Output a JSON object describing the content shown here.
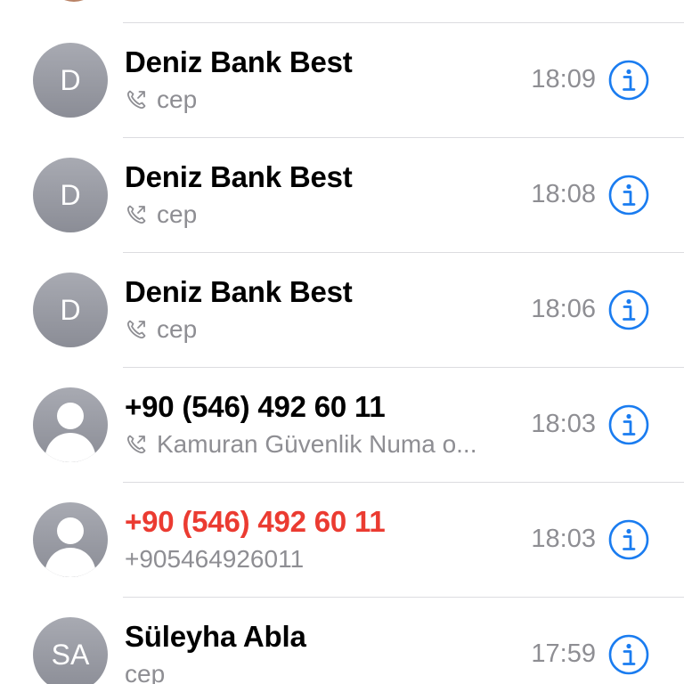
{
  "calls": [
    {
      "initials": "D",
      "avatar_type": "initials",
      "name": "Deniz Bank Best",
      "missed": false,
      "show_call_icon": true,
      "subtitle": "cep",
      "time": "18:09"
    },
    {
      "initials": "D",
      "avatar_type": "initials",
      "name": "Deniz Bank Best",
      "missed": false,
      "show_call_icon": true,
      "subtitle": "cep",
      "time": "18:08"
    },
    {
      "initials": "D",
      "avatar_type": "initials",
      "name": "Deniz Bank Best",
      "missed": false,
      "show_call_icon": true,
      "subtitle": "cep",
      "time": "18:06"
    },
    {
      "initials": "",
      "avatar_type": "silhouette",
      "name": "+90 (546) 492 60 11",
      "missed": false,
      "show_call_icon": true,
      "subtitle": "Kamuran Güvenlik Numa o...",
      "time": "18:03"
    },
    {
      "initials": "",
      "avatar_type": "silhouette",
      "name": "+90 (546) 492 60 11",
      "missed": true,
      "show_call_icon": false,
      "subtitle": "+905464926011",
      "time": "18:03"
    },
    {
      "initials": "SA",
      "avatar_type": "initials",
      "name": "Süleyha Abla",
      "missed": false,
      "show_call_icon": false,
      "subtitle": "cep",
      "time": "17:59"
    }
  ],
  "icons": {
    "info": "info-circle-icon",
    "outgoing_call": "outgoing-call-icon",
    "contact_placeholder": "person-silhouette-icon"
  },
  "colors": {
    "accent_blue": "#1a7cf0",
    "missed_red": "#eb3b31",
    "secondary_gray": "#8e8e93",
    "avatar_gray": "#9a9ca4"
  }
}
